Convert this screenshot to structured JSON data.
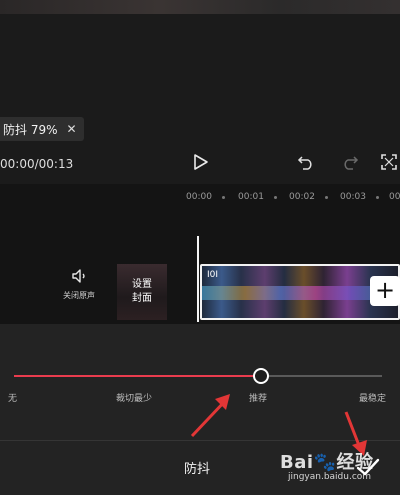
{
  "toast": {
    "label": "防抖 79%",
    "close_icon": "close-icon"
  },
  "player": {
    "time": "00:00/00:13"
  },
  "ruler": {
    "ticks": [
      "00:00",
      "00:01",
      "00:02",
      "00:03",
      "00:0"
    ]
  },
  "timeline": {
    "mute_label": "关闭原声",
    "cover_line1": "设置",
    "cover_line2": "封面",
    "clip_label": "I0I"
  },
  "stabilize": {
    "levels": [
      "无",
      "裁切最少",
      "推荐",
      "最稳定"
    ],
    "selected": "推荐",
    "value": 0.67,
    "accent": "#ea3c4e"
  },
  "panel": {
    "title": "防抖"
  },
  "watermark": {
    "brand": "Bai",
    "brand2": "经验",
    "url": "jingyan.baidu.com"
  },
  "annotation_color": "#e23636"
}
